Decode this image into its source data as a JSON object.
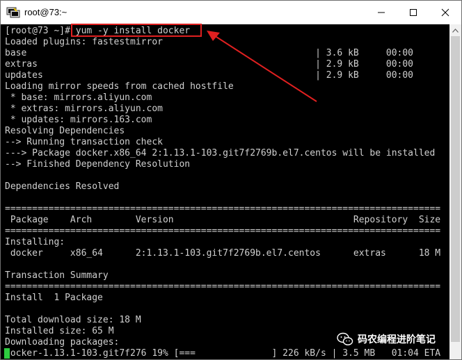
{
  "window": {
    "title": "root@73:~",
    "icon": "putty-terminal-icon",
    "controls": [
      "minimize-icon",
      "maximize-icon",
      "close-icon"
    ]
  },
  "terminal": {
    "lines": [
      "[root@73 ~]# yum -y install docker",
      "Loaded plugins: fastestmirror",
      "base                                                     | 3.6 kB     00:00",
      "extras                                                   | 2.9 kB     00:00",
      "updates                                                  | 2.9 kB     00:00",
      "Loading mirror speeds from cached hostfile",
      " * base: mirrors.aliyun.com",
      " * extras: mirrors.aliyun.com",
      " * updates: mirrors.163.com",
      "Resolving Dependencies",
      "--> Running transaction check",
      "---> Package docker.x86_64 2:1.13.1-103.git7f2769b.el7.centos will be installed",
      "--> Finished Dependency Resolution",
      "",
      "Dependencies Resolved",
      "",
      "================================================================================",
      " Package    Arch        Version                                 Repository  Size",
      "================================================================================",
      "Installing:",
      " docker     x86_64      2:1.13.1-103.git7f2769b.el7.centos      extras      18 M",
      "",
      "Transaction Summary",
      "================================================================================",
      "Install  1 Package",
      "",
      "Total download size: 18 M",
      "Installed size: 65 M",
      "Downloading packages:",
      "docker-1.13.1-103.git7f276 19% [===              ] 226 kB/s | 3.5 MB   01:04 ETA"
    ],
    "highlighted_command": "yum -y install docker"
  },
  "watermark": {
    "text": "码农编程进阶笔记",
    "icon": "wechat-icon"
  },
  "colors": {
    "terminal_bg": "#000000",
    "terminal_fg": "#d0d0d0",
    "annotation": "#e02020",
    "cursor": "#2ecc40"
  }
}
